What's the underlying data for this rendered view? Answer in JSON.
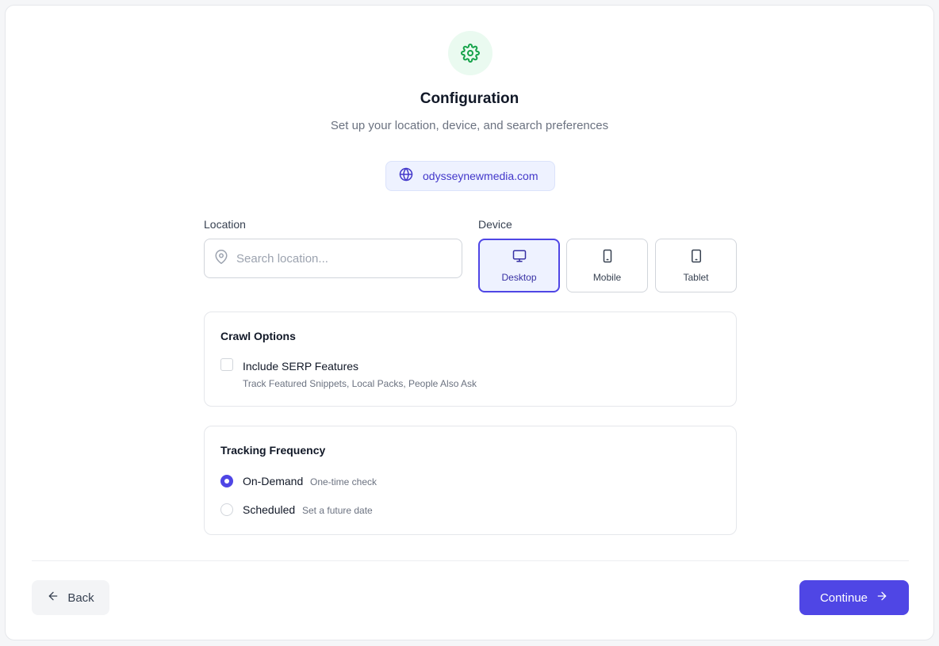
{
  "header": {
    "title": "Configuration",
    "subtitle": "Set up your location, device, and search preferences",
    "icon": "gear-icon",
    "accent_color": "#16a34a"
  },
  "domain": {
    "value": "odysseynewmedia.com",
    "icon": "globe-icon"
  },
  "location": {
    "label": "Location",
    "placeholder": "Search location...",
    "value": ""
  },
  "device": {
    "label": "Device",
    "selected": "Desktop",
    "options": [
      {
        "label": "Desktop",
        "icon": "desktop-icon"
      },
      {
        "label": "Mobile",
        "icon": "mobile-icon"
      },
      {
        "label": "Tablet",
        "icon": "tablet-icon"
      }
    ]
  },
  "crawl_options": {
    "title": "Crawl Options",
    "serp": {
      "label": "Include SERP Features",
      "help": "Track Featured Snippets, Local Packs, People Also Ask",
      "checked": false
    }
  },
  "tracking": {
    "title": "Tracking Frequency",
    "selected": "On-Demand",
    "options": [
      {
        "label": "On-Demand",
        "help": "One-time check"
      },
      {
        "label": "Scheduled",
        "help": "Set a future date"
      }
    ]
  },
  "footer": {
    "back_label": "Back",
    "continue_label": "Continue",
    "primary_color": "#4f46e5"
  }
}
